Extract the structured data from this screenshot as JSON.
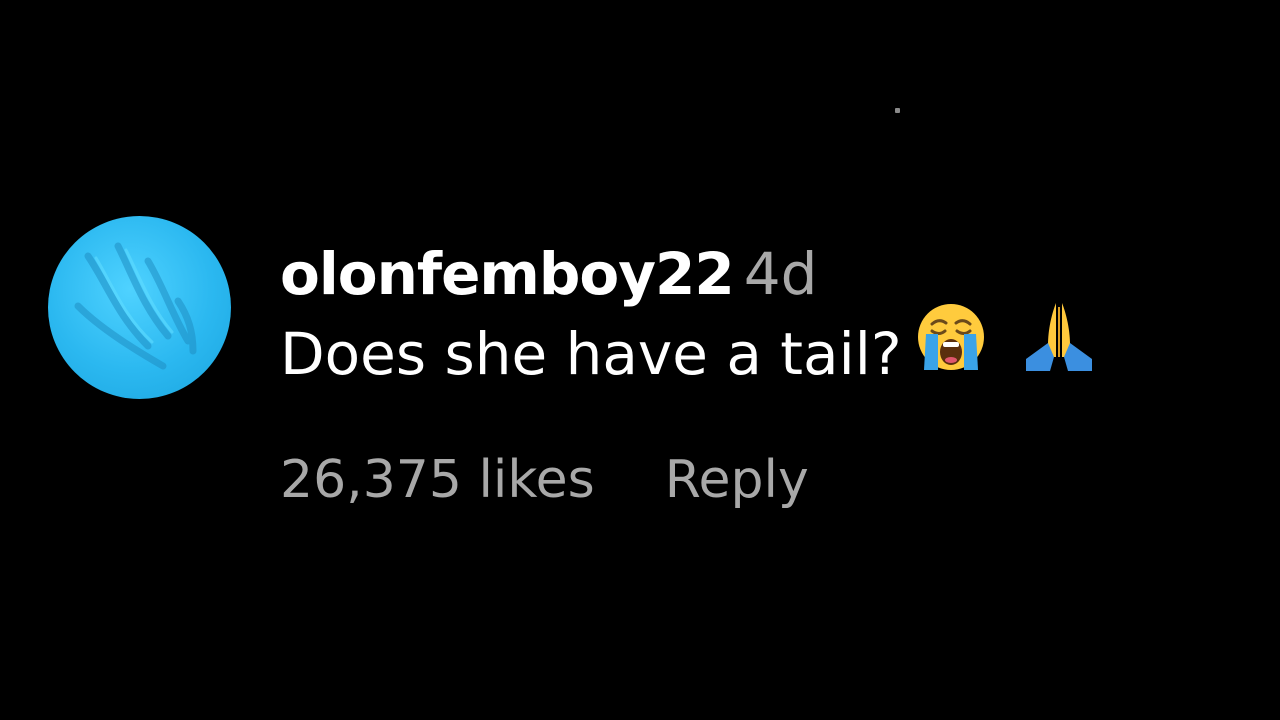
{
  "comment": {
    "username": "olonfemboy22",
    "timestamp": "4d",
    "text": "Does she have a tail?",
    "emojis": [
      "loudly-crying-face-icon",
      "folded-hands-icon"
    ],
    "likes_label": "26,375 likes",
    "reply_label": "Reply"
  },
  "colors": {
    "background": "#000000",
    "username": "#ffffff",
    "text": "#ffffff",
    "secondary": "#a8a8a8",
    "avatar": "#2bb8f0"
  }
}
